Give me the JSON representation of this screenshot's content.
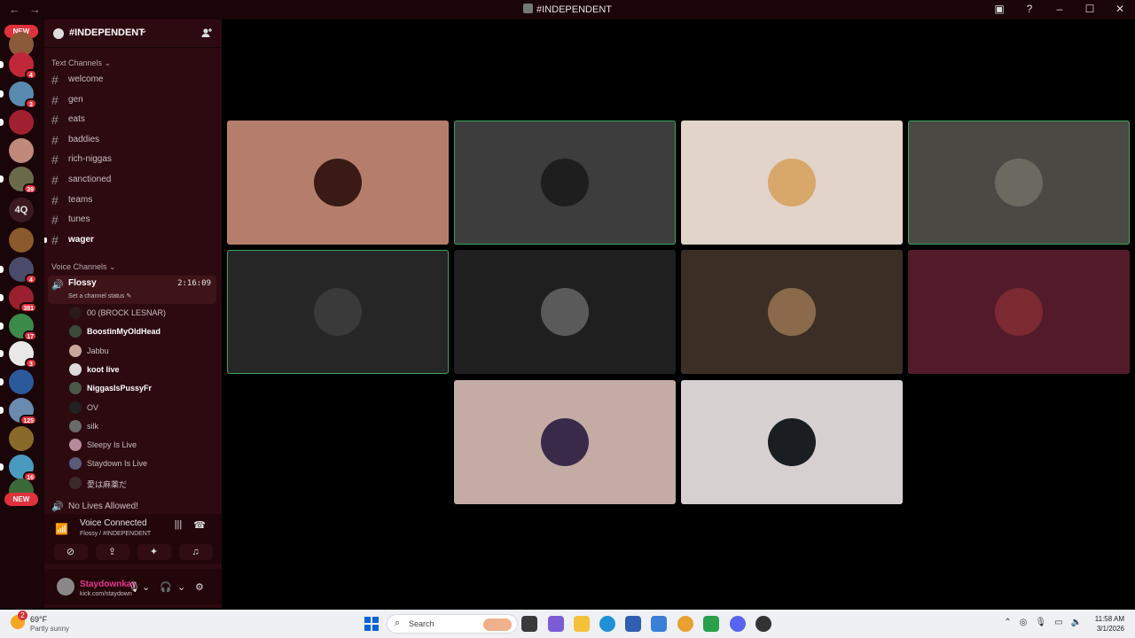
{
  "window": {
    "title": "#INDEPENDENT",
    "back_glyph": "←",
    "forward_glyph": "→"
  },
  "rail": {
    "new_label_top": "NEW",
    "new_label_bottom": "NEW",
    "text_server": "4Q",
    "badges": [
      "4",
      "3",
      "39",
      "4",
      "381",
      "17",
      "3",
      "125",
      "16"
    ]
  },
  "server": {
    "name": "#INDEPENDENT"
  },
  "text_channels": {
    "category": "Text Channels",
    "items": [
      "welcome",
      "gen",
      "eats",
      "baddies",
      "rich-niggas",
      "sanctioned",
      "teams",
      "tunes",
      "wager"
    ]
  },
  "voice_channels": {
    "category": "Voice Channels",
    "active": {
      "name": "Flossy",
      "timer": "2:16:09",
      "status_placeholder": "Set a channel status"
    },
    "members": [
      {
        "name": "00 (BROCK LESNAR)",
        "bold": false,
        "color": "#2a1a1a"
      },
      {
        "name": "BoostinMyOldHead",
        "bold": true,
        "color": "#3a4a3a"
      },
      {
        "name": "Jabbu",
        "bold": false,
        "color": "#c9a79a"
      },
      {
        "name": "koot live",
        "bold": true,
        "color": "#dcdcdc"
      },
      {
        "name": "NiggasIsPussyFr",
        "bold": true,
        "color": "#4a5a4a"
      },
      {
        "name": "OV",
        "bold": false,
        "color": "#222222"
      },
      {
        "name": "silk",
        "bold": false,
        "color": "#6a6a6a"
      },
      {
        "name": "Sleepy Is Live",
        "bold": false,
        "color": "#b58a9a"
      },
      {
        "name": "Staydown Is Live",
        "bold": false,
        "color": "#5a5a7a"
      },
      {
        "name": "愛は麻薬だ",
        "bold": false,
        "color": "#3a2a2a"
      }
    ],
    "other": "No Lives Allowed!"
  },
  "voice_panel": {
    "title": "Voice Connected",
    "subtitle": "Flossy / #INDEPENDENT"
  },
  "user": {
    "name": "Staydownkay",
    "status": "kick.com/staydown"
  },
  "tiles": [
    {
      "bg": "#b57e6c",
      "avatar": "#3a1a14",
      "speaking": false
    },
    {
      "bg": "#3d3d3d",
      "avatar": "#1e1e1e",
      "speaking": true
    },
    {
      "bg": "#e2d4ca",
      "avatar": "#d8a76a",
      "speaking": false
    },
    {
      "bg": "#4a4944",
      "avatar": "#6a6a60",
      "speaking": true
    },
    {
      "bg": "#262626",
      "avatar": "#3a3a3a",
      "speaking": true
    },
    {
      "bg": "#1f1f1f",
      "avatar": "#5a5a5a",
      "speaking": false
    },
    {
      "bg": "#3b2f25",
      "avatar": "#8a6a4a",
      "speaking": false
    },
    {
      "bg": "#531b2a",
      "avatar": "#7a2a30",
      "speaking": false
    },
    {
      "bg": "#c4aca4",
      "avatar": "#3a2a4a",
      "speaking": false
    },
    {
      "bg": "#d6d0d0",
      "avatar": "#1a1e22",
      "speaking": false
    }
  ],
  "taskbar": {
    "weather_badge": "2",
    "temp": "69°F",
    "condition": "Partly sunny",
    "search_label": "Search",
    "time": "11:58 AM",
    "date": "3/1/2026"
  }
}
